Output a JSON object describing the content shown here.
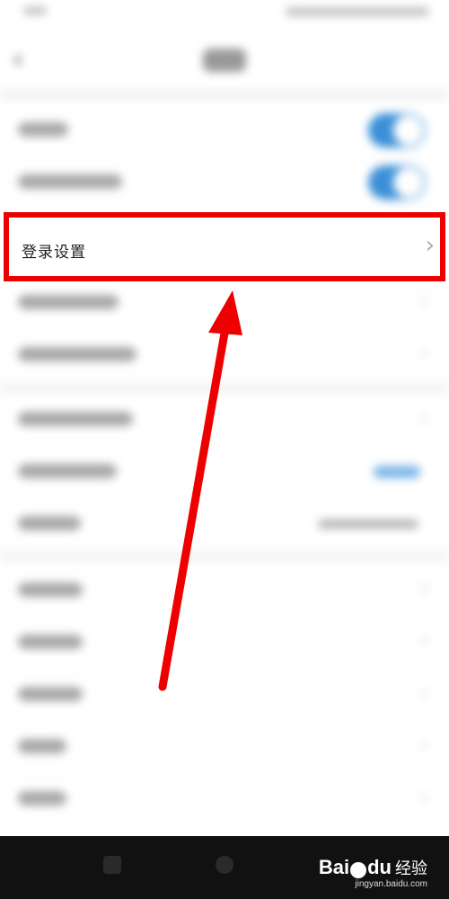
{
  "header": {
    "back_icon": "‹"
  },
  "settings": {
    "login_settings_label": "登录设置",
    "chevron": "›"
  },
  "watermark": {
    "brand": "Bai",
    "brand_suffix": "du",
    "cn": "经验",
    "site": "jingyan.baidu.com"
  },
  "colors": {
    "highlight": "#ee0000",
    "toggle_on": "#3a8fd8",
    "arrow": "#ee0000"
  },
  "icons": {
    "back": "chevron-left-icon",
    "row_chevron": "chevron-right-icon",
    "arrow": "annotation-arrow-icon"
  }
}
